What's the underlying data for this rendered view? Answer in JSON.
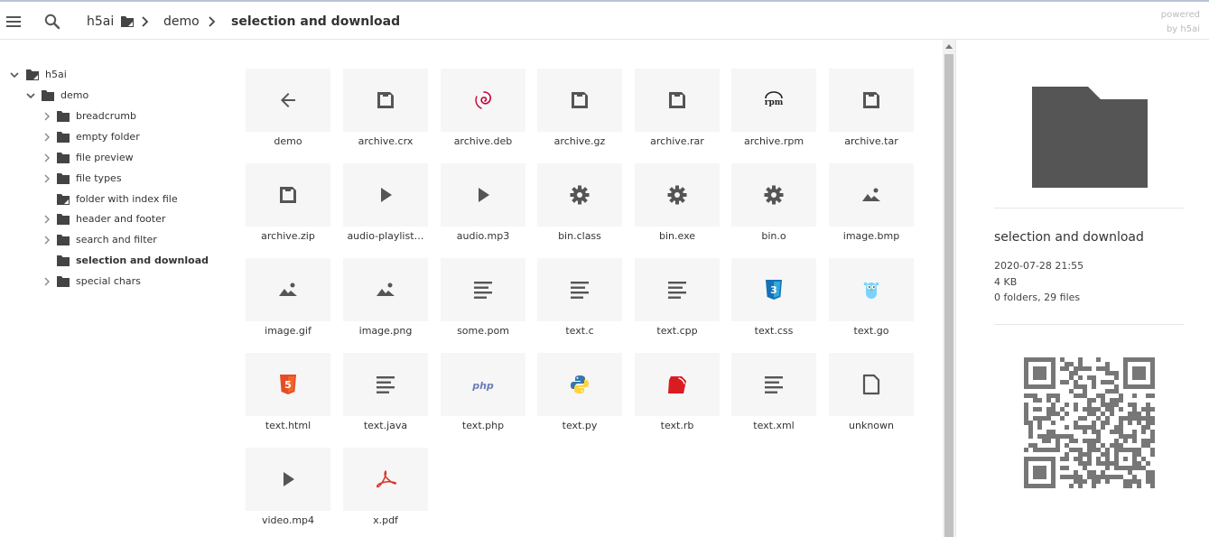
{
  "app": {
    "powered_line1": "powered",
    "powered_line2": "by h5ai"
  },
  "topbar": {
    "menu_icon": "hamburger-menu-icon",
    "search_icon": "search-icon",
    "breadcrumb": [
      {
        "label": "h5ai"
      },
      {
        "label": "demo"
      },
      {
        "label": "selection and download"
      }
    ]
  },
  "tree": {
    "root": {
      "label": "h5ai"
    },
    "demo": {
      "label": "demo"
    },
    "items": [
      {
        "label": "breadcrumb"
      },
      {
        "label": "empty folder"
      },
      {
        "label": "file preview"
      },
      {
        "label": "file types"
      },
      {
        "label": "folder with index file"
      },
      {
        "label": "header and footer"
      },
      {
        "label": "search and filter"
      },
      {
        "label": "selection and download"
      },
      {
        "label": "special chars"
      }
    ]
  },
  "files": [
    {
      "name": "demo",
      "icon": "back-arrow-icon"
    },
    {
      "name": "archive.crx",
      "icon": "archive-icon"
    },
    {
      "name": "archive.deb",
      "icon": "debian-icon"
    },
    {
      "name": "archive.gz",
      "icon": "archive-icon"
    },
    {
      "name": "archive.rar",
      "icon": "archive-icon"
    },
    {
      "name": "archive.rpm",
      "icon": "rpm-icon"
    },
    {
      "name": "archive.tar",
      "icon": "archive-icon"
    },
    {
      "name": "archive.zip",
      "icon": "archive-icon"
    },
    {
      "name": "audio-playlist…",
      "icon": "play-icon"
    },
    {
      "name": "audio.mp3",
      "icon": "play-icon"
    },
    {
      "name": "bin.class",
      "icon": "gear-icon"
    },
    {
      "name": "bin.exe",
      "icon": "gear-icon"
    },
    {
      "name": "bin.o",
      "icon": "gear-icon"
    },
    {
      "name": "image.bmp",
      "icon": "image-icon"
    },
    {
      "name": "image.gif",
      "icon": "image-icon"
    },
    {
      "name": "image.png",
      "icon": "image-icon"
    },
    {
      "name": "some.pom",
      "icon": "text-lines-icon"
    },
    {
      "name": "text.c",
      "icon": "text-lines-icon"
    },
    {
      "name": "text.cpp",
      "icon": "text-lines-icon"
    },
    {
      "name": "text.css",
      "icon": "css3-icon"
    },
    {
      "name": "text.go",
      "icon": "go-gopher-icon"
    },
    {
      "name": "text.html",
      "icon": "html5-icon"
    },
    {
      "name": "text.java",
      "icon": "text-lines-icon"
    },
    {
      "name": "text.php",
      "icon": "php-icon"
    },
    {
      "name": "text.py",
      "icon": "python-icon"
    },
    {
      "name": "text.rb",
      "icon": "ruby-icon"
    },
    {
      "name": "text.xml",
      "icon": "text-lines-icon"
    },
    {
      "name": "unknown",
      "icon": "blank-file-icon"
    },
    {
      "name": "video.mp4",
      "icon": "play-icon"
    },
    {
      "name": "x.pdf",
      "icon": "pdf-icon"
    }
  ],
  "info": {
    "icon": "folder-icon",
    "name": "selection and download",
    "date": "2020-07-28 21:55",
    "size": "4 KB",
    "count": "0 folders, 29 files",
    "qr": "qr-code-image"
  },
  "colors": {
    "icon_gray": "#555555",
    "tile_bg": "#f6f6f6",
    "css3_blue": "#1572b6",
    "html5_orange": "#e44d26",
    "ruby_red": "#d91c22",
    "debian_red": "#c70036",
    "python_blue": "#3776ab",
    "python_yellow": "#ffd43b",
    "pdf_red": "#d9342b",
    "php_purple": "#6c7eb7",
    "go_cyan": "#79d4fd"
  }
}
